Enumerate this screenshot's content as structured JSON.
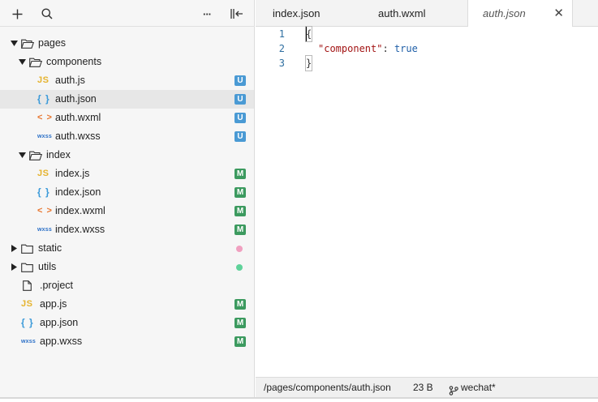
{
  "toolbar": {
    "add_icon": "plus-icon",
    "search_icon": "search-icon",
    "more_label": "···",
    "collapse_icon": "collapse-sidebar-icon"
  },
  "tree": [
    {
      "label": "pages",
      "type": "folder",
      "expanded": true,
      "depth": 0
    },
    {
      "label": "components",
      "type": "folder",
      "expanded": true,
      "depth": 1
    },
    {
      "label": "auth.js",
      "type": "js",
      "icon_text": "JS",
      "depth": 2,
      "badge": "U"
    },
    {
      "label": "auth.json",
      "type": "json",
      "icon_text": "{ }",
      "depth": 2,
      "badge": "U",
      "selected": true
    },
    {
      "label": "auth.wxml",
      "type": "wxml",
      "icon_text": "< >",
      "depth": 2,
      "badge": "U"
    },
    {
      "label": "auth.wxss",
      "type": "wxss",
      "icon_text": "wxss",
      "depth": 2,
      "badge": "U"
    },
    {
      "label": "index",
      "type": "folder",
      "expanded": true,
      "depth": 1
    },
    {
      "label": "index.js",
      "type": "js",
      "icon_text": "JS",
      "depth": 2,
      "badge": "M"
    },
    {
      "label": "index.json",
      "type": "json",
      "icon_text": "{ }",
      "depth": 2,
      "badge": "M"
    },
    {
      "label": "index.wxml",
      "type": "wxml",
      "icon_text": "< >",
      "depth": 2,
      "badge": "M"
    },
    {
      "label": "index.wxss",
      "type": "wxss",
      "icon_text": "wxss",
      "depth": 2,
      "badge": "M"
    },
    {
      "label": "static",
      "type": "folder",
      "expanded": false,
      "depth": 0,
      "dot": "#f0a0c0"
    },
    {
      "label": "utils",
      "type": "folder",
      "expanded": false,
      "depth": 0,
      "dot": "#5fd29a"
    },
    {
      "label": ".project",
      "type": "file",
      "depth": 0
    },
    {
      "label": "app.js",
      "type": "js",
      "icon_text": "JS",
      "depth": 0,
      "badge": "M"
    },
    {
      "label": "app.json",
      "type": "json",
      "icon_text": "{ }",
      "depth": 0,
      "badge": "M"
    },
    {
      "label": "app.wxss",
      "type": "wxss",
      "icon_text": "wxss",
      "depth": 0,
      "badge": "M"
    }
  ],
  "colors": {
    "badge_U": "#4a9ad4",
    "badge_M": "#3c9a5f"
  },
  "tabs": [
    {
      "label": "index.json",
      "active": false
    },
    {
      "label": "auth.wxml",
      "active": false
    },
    {
      "label": "auth.json",
      "active": true
    }
  ],
  "tab_close": "✕",
  "editor": {
    "lines": [
      {
        "num": "1",
        "text": "{"
      },
      {
        "num": "2",
        "key": "\"component\"",
        "sep": ": ",
        "value": "true"
      },
      {
        "num": "3",
        "text": "}"
      }
    ]
  },
  "status": {
    "path": "/pages/components/auth.json",
    "size": "23 B",
    "branch": "wechat*"
  }
}
